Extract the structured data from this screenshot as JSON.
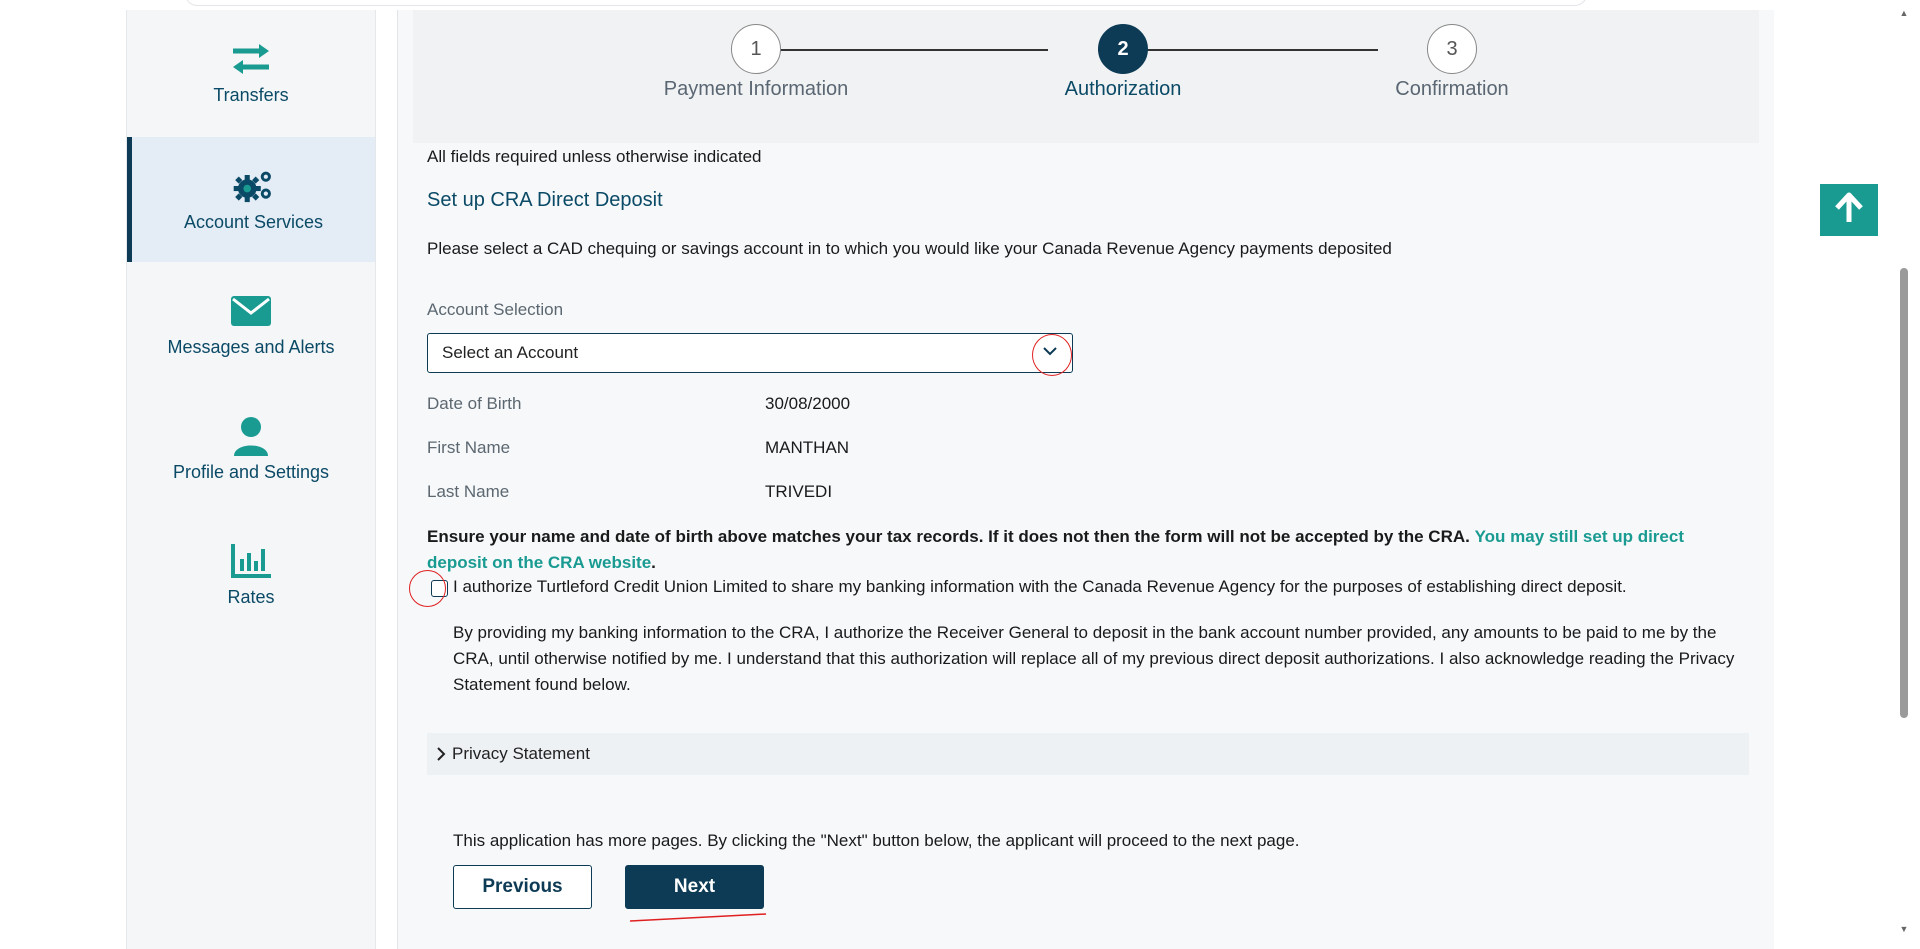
{
  "sidebar": {
    "items": [
      {
        "label": "Transfers",
        "icon": "transfer-arrows-icon"
      },
      {
        "label": "Account Services",
        "icon": "gears-icon"
      },
      {
        "label": "Messages and Alerts",
        "icon": "envelope-icon"
      },
      {
        "label": "Profile and Settings",
        "icon": "person-icon"
      },
      {
        "label": "Rates",
        "icon": "bar-chart-icon"
      }
    ]
  },
  "stepper": {
    "steps": [
      {
        "number": "1",
        "label": "Payment Information"
      },
      {
        "number": "2",
        "label": "Authorization"
      },
      {
        "number": "3",
        "label": "Confirmation"
      }
    ]
  },
  "form": {
    "required_note": "All fields required unless otherwise indicated",
    "heading": "Set up CRA Direct Deposit",
    "instruction": "Please select a CAD chequing or savings account in to which you would like your Canada Revenue Agency payments deposited",
    "account_label": "Account Selection",
    "account_value": "Select an Account",
    "fields": [
      {
        "label": "Date of Birth",
        "value": "30/08/2000"
      },
      {
        "label": "First Name",
        "value": "MANTHAN"
      },
      {
        "label": "Last Name",
        "value": "TRIVEDI"
      }
    ],
    "warning_bold": "Ensure your name and date of birth above matches your tax records. If it does not then the form will not be accepted by the CRA.",
    "warning_link": "You may still set up direct deposit on the CRA website",
    "warning_end": ".",
    "authorize_label": "I authorize Turtleford Credit Union Limited to share my banking information with the Canada Revenue Agency for the purposes of establishing direct deposit.",
    "authorize_detail": "By providing my banking information to the CRA, I authorize the Receiver General to deposit in the bank account number provided, any amounts to be paid to me by the CRA, until otherwise notified by me. I understand that this authorization will replace all of my previous direct deposit authorizations. I also acknowledge reading the Privacy Statement found below.",
    "privacy_label": "Privacy Statement",
    "pages_note": "This application has more pages. By clicking the \"Next\" button below, the applicant will proceed to the next page.",
    "previous_label": "Previous",
    "next_label": "Next"
  },
  "colors": {
    "brand_dark": "#0d3b55",
    "teal": "#1a9b92",
    "annotation_red": "#e02020"
  }
}
